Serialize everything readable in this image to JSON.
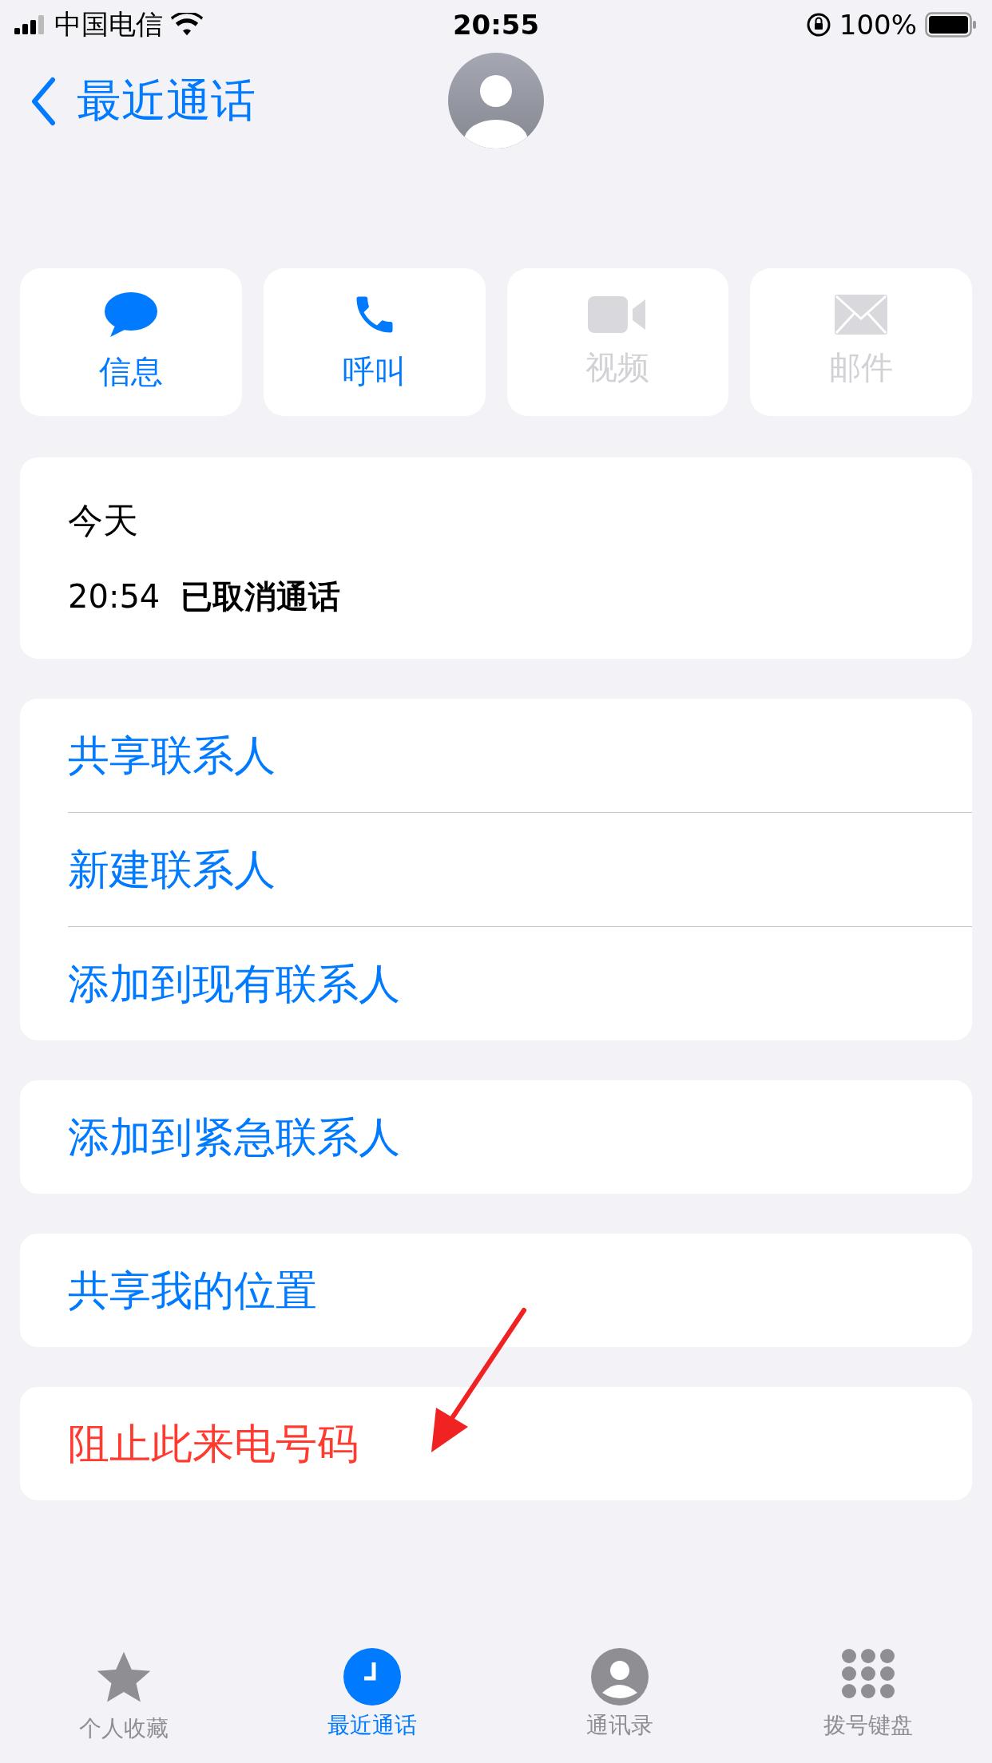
{
  "status_bar": {
    "carrier": "中国电信",
    "time": "20:55",
    "battery": "100%"
  },
  "nav": {
    "back": "最近通话"
  },
  "actions": [
    {
      "kind": "message",
      "label": "信息",
      "disabled": false
    },
    {
      "kind": "call",
      "label": "呼叫",
      "disabled": false
    },
    {
      "kind": "video",
      "label": "视频",
      "disabled": true
    },
    {
      "kind": "mail",
      "label": "邮件",
      "disabled": true
    }
  ],
  "call_log": {
    "day": "今天",
    "time": "20:54",
    "status": "已取消通话"
  },
  "groups": [
    [
      {
        "label": "共享联系人",
        "kind": "normal"
      },
      {
        "label": "新建联系人",
        "kind": "normal"
      },
      {
        "label": "添加到现有联系人",
        "kind": "normal"
      }
    ],
    [
      {
        "label": "添加到紧急联系人",
        "kind": "normal"
      }
    ],
    [
      {
        "label": "共享我的位置",
        "kind": "normal"
      }
    ],
    [
      {
        "label": "阻止此来电号码",
        "kind": "destructive"
      }
    ]
  ],
  "tab_bar": [
    {
      "kind": "favorites",
      "label": "个人收藏",
      "selected": false
    },
    {
      "kind": "recents",
      "label": "最近通话",
      "selected": true
    },
    {
      "kind": "contacts",
      "label": "通讯录",
      "selected": false
    },
    {
      "kind": "keypad",
      "label": "拨号键盘",
      "selected": false
    }
  ]
}
